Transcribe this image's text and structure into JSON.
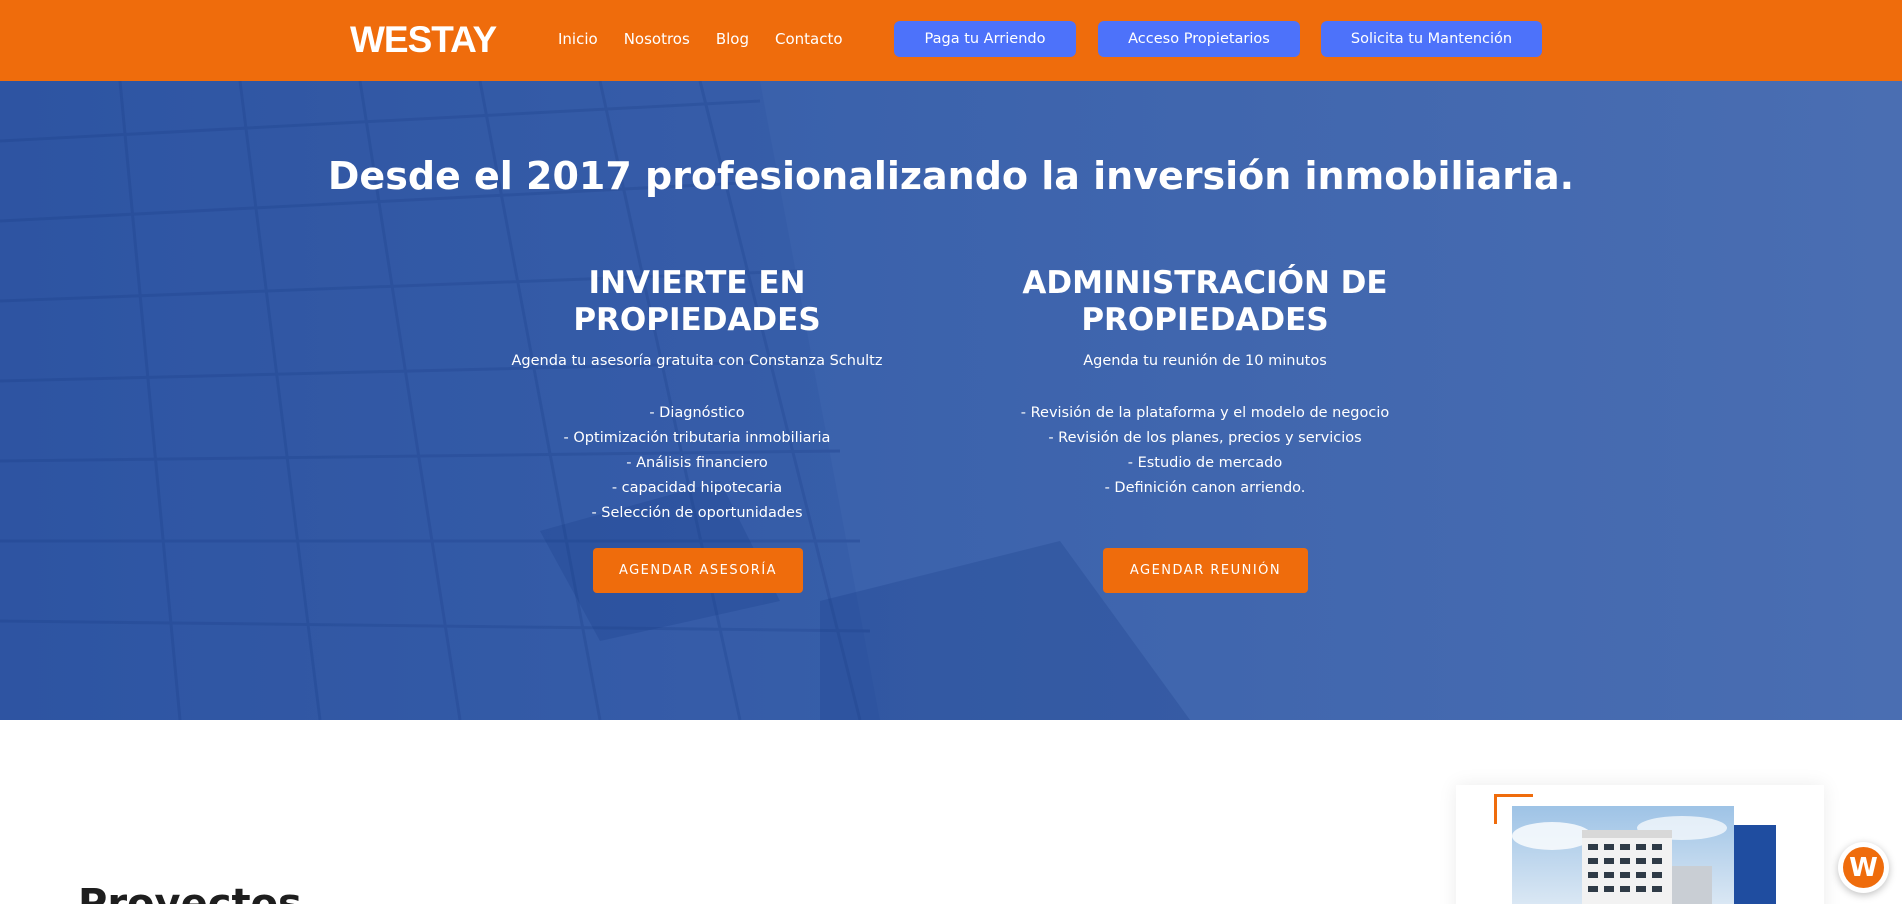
{
  "header": {
    "logo": "WESTAY",
    "nav": [
      "Inicio",
      "Nosotros",
      "Blog",
      "Contacto"
    ],
    "buttons": [
      "Paga tu Arriendo",
      "Acceso Propietarios",
      "Solicita tu Mantención"
    ]
  },
  "hero": {
    "title": "Desde el 2017 profesionalizando la inversión inmobiliaria.",
    "left": {
      "heading_line1": "INVIERTE EN",
      "heading_line2": "PROPIEDADES",
      "subtitle": "Agenda tu asesoría gratuita con Constanza Schultz",
      "items": [
        "- Diagnóstico",
        "- Optimización tributaria inmobiliaria",
        "- Análisis financiero",
        "- capacidad hipotecaria",
        "- Selección de oportunidades"
      ],
      "button": "AGENDAR ASESORÍA"
    },
    "right": {
      "heading_line1": "ADMINISTRACIÓN DE",
      "heading_line2": "PROPIEDADES",
      "subtitle": "Agenda tu reunión de 10 minutos",
      "items": [
        "- Revisión de la plataforma y el modelo de negocio",
        "- Revisión de los planes, precios y servicios",
        "- Estudio de mercado",
        "- Definición canon arriendo."
      ],
      "button": "AGENDAR REUNIÓN"
    }
  },
  "projects": {
    "title": "Proyectos"
  },
  "chat": {
    "icon": "westay-chat-icon",
    "letter": "W"
  },
  "colors": {
    "brand_orange": "#ef6c0c",
    "hero_blue": "#3f66ad",
    "button_blue": "#4d72fa"
  }
}
